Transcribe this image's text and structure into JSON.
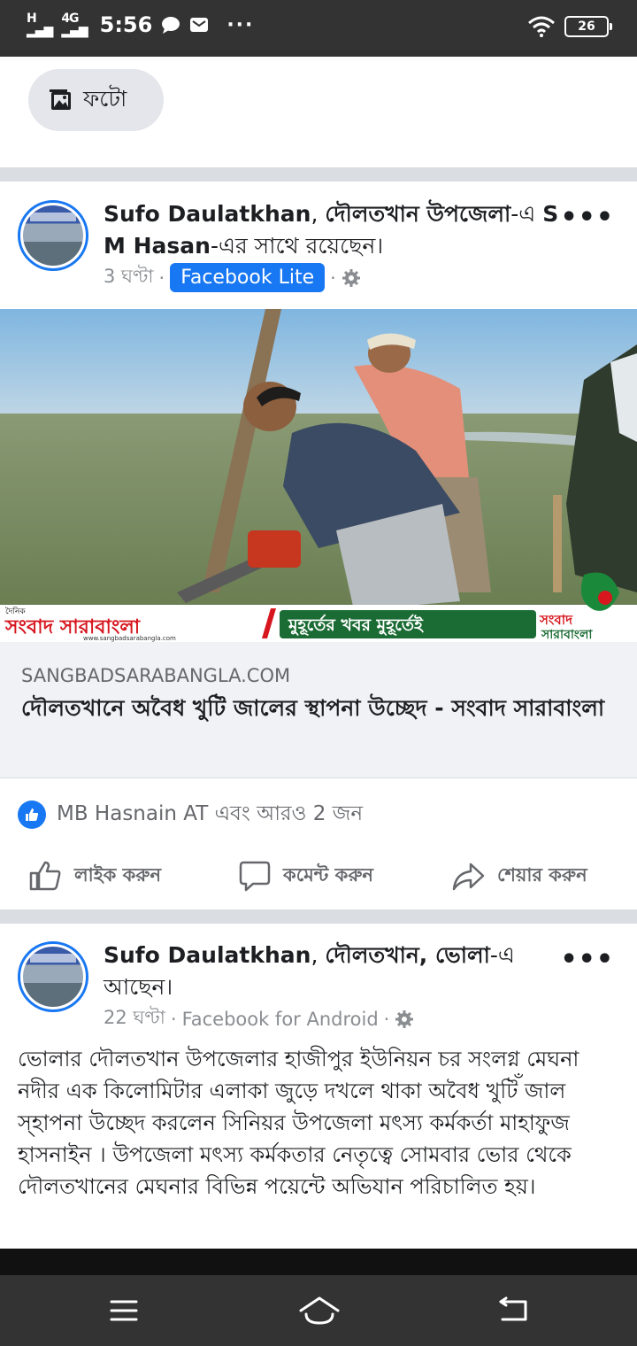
{
  "status_bar": {
    "signal1": "H",
    "signal2": "4G",
    "time": "5:56",
    "more_indicator": "···",
    "battery": "26",
    "icons": [
      "chat-bubble-icon",
      "mail-icon",
      "wifi-icon",
      "battery-icon"
    ]
  },
  "composer": {
    "photo_label": "ফটো",
    "icon": "photo-icon"
  },
  "post1": {
    "author": "Sufo Daulatkhan",
    "title_sep1": ", ",
    "location": "দৌলতখান উপজেলা",
    "title_mid": "-এ ",
    "tagged": "S M Hasan",
    "title_end": "-এর সাথে রয়েছেন।",
    "time": "3 ঘণ্টা",
    "dot": "·",
    "source": "Facebook Lite",
    "more": "•••",
    "image_banner": {
      "paper_small": "দৈনিক",
      "paper_name": "সংবাদ সারাবাংলা",
      "website_small": "www.sangbadsarabangla.com",
      "tagline": "মুহূর্তের খবর মুহূর্তেই",
      "logo_text_1": "সংবাদ",
      "logo_text_2": "সারাবাংলা"
    },
    "link": {
      "domain": "SANGBADSARABANGLA.COM",
      "title": "দৌলতখানে অবৈধ খুটি জালের স্থাপনা উচ্ছেদ - সংবাদ সারাবাংলা"
    },
    "reactions": "MB Hasnain AT এবং আরও 2 জন",
    "actions": {
      "like": "লাইক করুন",
      "comment": "কমেন্ট করুন",
      "share": "শেয়ার করুন"
    }
  },
  "post2": {
    "author": "Sufo Daulatkhan",
    "title_sep1": ", ",
    "location": "দৌলতখান, ভোলা",
    "title_end": "-এ আছেন।",
    "time": "22 ঘণ্টা",
    "dot": "·",
    "source": "Facebook for Android",
    "more": "•••",
    "body": "ভোলার দৌলতখান উপজেলার হাজীপুর ইউনিয়ন চর সংলগ্ন মেঘনা নদীর এক কিলোমিটার এলাকা জুড়ে দখলে থাকা অবৈধ খুটিঁ জাল স্হাপনা উচ্ছেদ করলেন সিনিয়র উপজেলা মৎস্য কর্মকর্তা মাহাফুজ হাসনাইন । উপজেলা মৎস্য কর্মকতার নেতৃত্বে সোমবার ভোর থেকে দৌলতখানের মেঘনার বিভিন্ন পয়েন্টে অভিযান পরিচালিত হয়।"
  },
  "colors": {
    "facebook_blue": "#1877f2",
    "status_bar": "#333333",
    "banner_red": "#d7161e",
    "banner_green": "#1a6b34"
  }
}
